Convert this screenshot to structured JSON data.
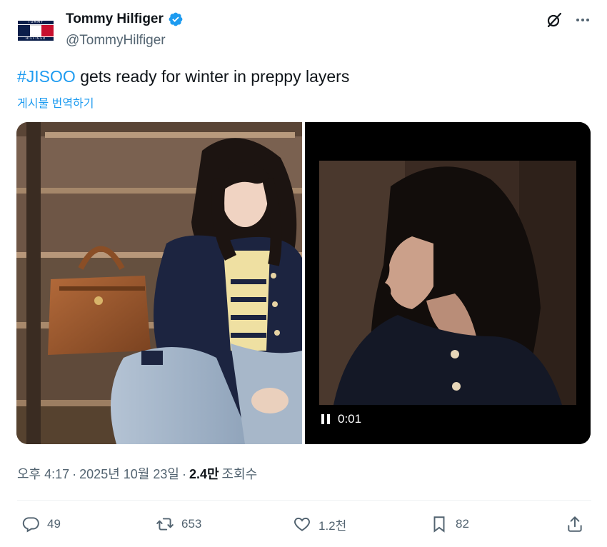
{
  "author": {
    "name": "Tommy Hilfiger",
    "handle": "@TommyHilfiger",
    "avatar_band_top": "TOMMY",
    "avatar_band_bottom": "HILFIGER",
    "verified": true,
    "flag_colors": [
      "#0b1e4a",
      "#ffffff",
      "#c8102e"
    ]
  },
  "tweet": {
    "hashtag": "#JISOO",
    "text": " gets ready for winter in preppy layers",
    "translate_link": "게시물 번역하기"
  },
  "video": {
    "time": "0:01",
    "state": "playing"
  },
  "meta": {
    "time": "오후 4:17",
    "separator": "·",
    "date": "2025년 10월 23일",
    "views_count": "2.4만",
    "views_label": "조회수"
  },
  "actions": {
    "replies": "49",
    "reposts": "653",
    "likes": "1.2천",
    "bookmarks": "82"
  },
  "colors": {
    "accent": "#1d9bf0",
    "secondary_text": "#536471",
    "primary_text": "#0f1419"
  }
}
